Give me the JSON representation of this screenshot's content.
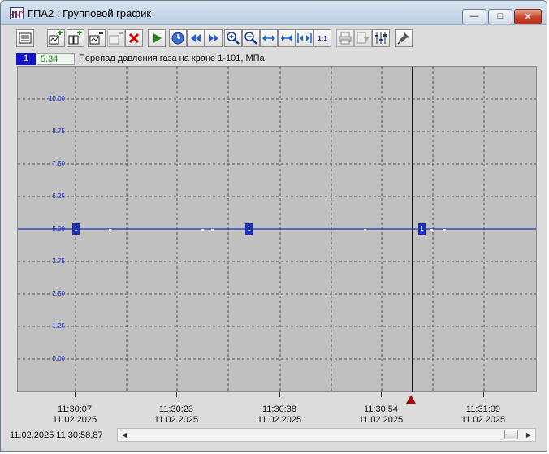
{
  "window": {
    "title": "ГПА2 : Групповой график",
    "buttons": {
      "minimize": "—",
      "maximize": "□",
      "close": "✕"
    }
  },
  "toolbar": {
    "items": [
      {
        "name": "list",
        "icon": "list-icon"
      },
      {
        "name": "add-trend",
        "icon": "add-chart-icon"
      },
      {
        "name": "add-group",
        "icon": "add-multi-chart-icon"
      },
      {
        "name": "edit-trend",
        "icon": "edit-chart-icon"
      },
      {
        "name": "remove-trend",
        "icon": "remove-chart-icon"
      },
      {
        "name": "delete",
        "icon": "red-x-icon"
      },
      {
        "name": "play",
        "icon": "play-icon"
      },
      {
        "name": "clock",
        "icon": "clock-icon"
      },
      {
        "name": "rewind",
        "icon": "rewind-icon"
      },
      {
        "name": "forward",
        "icon": "fast-forward-icon"
      },
      {
        "name": "zoom-in",
        "icon": "zoom-in-icon"
      },
      {
        "name": "zoom-out",
        "icon": "zoom-out-icon"
      },
      {
        "name": "fit-horizontal",
        "icon": "fit-horizontal-icon"
      },
      {
        "name": "expand-horizontal",
        "icon": "expand-horizontal-icon"
      },
      {
        "name": "shrink-horizontal",
        "icon": "shrink-horizontal-icon"
      },
      {
        "name": "scale-1-1",
        "label": "1:1"
      },
      {
        "name": "print",
        "icon": "printer-icon"
      },
      {
        "name": "export",
        "icon": "export-icon"
      },
      {
        "name": "settings",
        "icon": "sliders-icon"
      },
      {
        "name": "pin",
        "icon": "pin-icon"
      }
    ]
  },
  "legend": {
    "number": "1",
    "value": "5.34",
    "description": "Перепад давления газа на кране 1-101, МПа",
    "color": "#1414c8",
    "value_color": "#1f8a1f"
  },
  "chart_data": {
    "type": "line",
    "yticks": [
      "10.00",
      "8.75",
      "7.50",
      "6.25",
      "5.00",
      "3.75",
      "2.50",
      "1.25",
      "0.00"
    ],
    "ylim": [
      -1.25,
      11.25
    ],
    "xticks": [
      {
        "time": "11:30:07",
        "date": "11.02.2025"
      },
      {
        "time": "11:30:23",
        "date": "11.02.2025"
      },
      {
        "time": "11:30:38",
        "date": "11.02.2025"
      },
      {
        "time": "11:30:54",
        "date": "11.02.2025"
      },
      {
        "time": "11:31:09",
        "date": "11.02.2025"
      }
    ],
    "series": [
      {
        "name": "1",
        "color": "#1a2fc8",
        "values": [
          5.0,
          5.0
        ]
      }
    ],
    "marker_label": "1",
    "grid": true
  },
  "status": {
    "cursor_datetime": "11.02.2025 11:30:58,87"
  },
  "scrollbar": {
    "left_arrow": "◀",
    "right_arrow": "▶"
  }
}
